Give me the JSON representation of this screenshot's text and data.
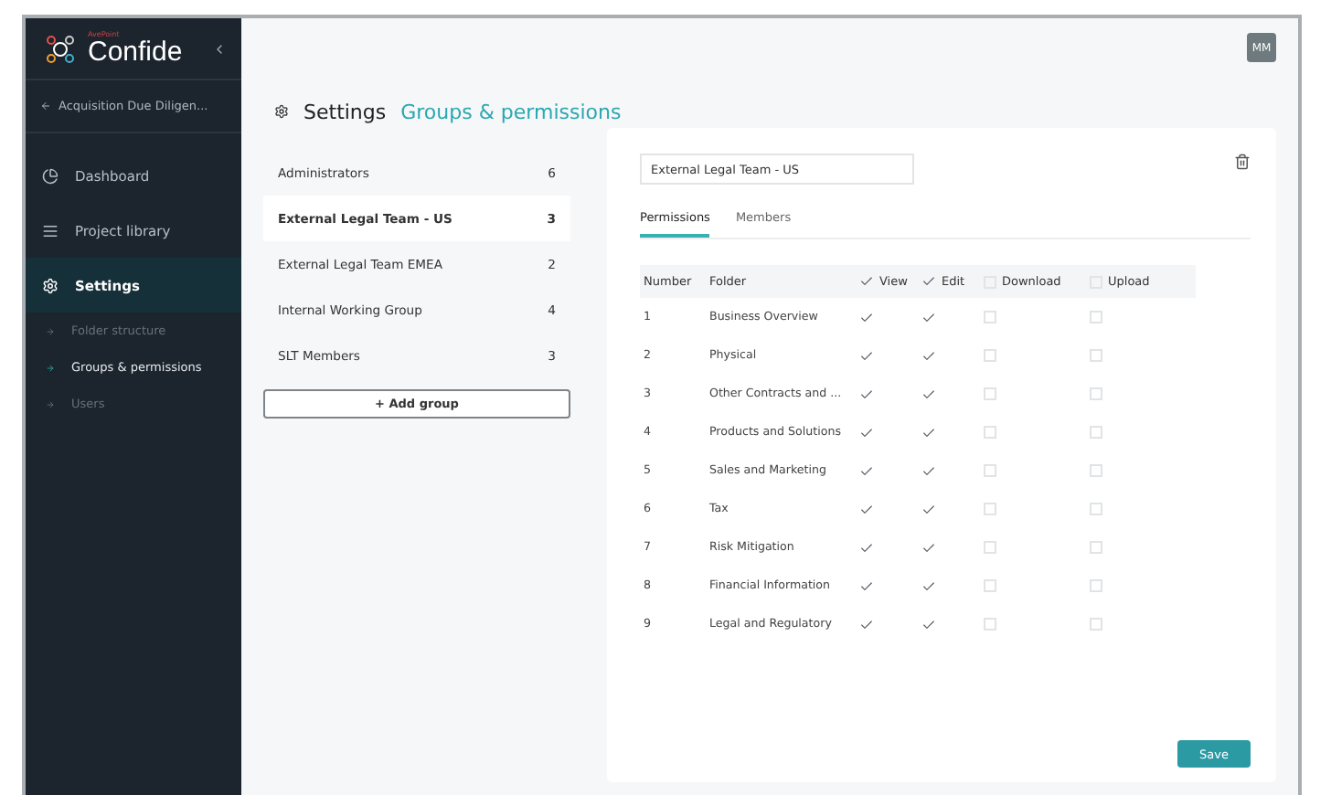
{
  "sidebar": {
    "brand_small": "AvePoint",
    "brand": "Confide",
    "back": "Acquisition Due Diligen...",
    "nav": [
      {
        "label": "Dashboard",
        "kind": "pie",
        "selected": false
      },
      {
        "label": "Project library",
        "kind": "list",
        "selected": false
      },
      {
        "label": "Settings",
        "kind": "gear",
        "selected": true
      }
    ],
    "sub": [
      {
        "label": "Folder structure",
        "selected": false
      },
      {
        "label": "Groups & permissions",
        "selected": true
      },
      {
        "label": "Users",
        "selected": false
      }
    ]
  },
  "header": {
    "avatar": "MM",
    "title": "Settings",
    "current": "Groups & permissions"
  },
  "groups": [
    {
      "name": "Administrators",
      "count": "6",
      "selected": false
    },
    {
      "name": "External Legal Team - US",
      "count": "3",
      "selected": true
    },
    {
      "name": "External Legal Team EMEA",
      "count": "2",
      "selected": false
    },
    {
      "name": "Internal Working Group",
      "count": "4",
      "selected": false
    },
    {
      "name": "SLT Members",
      "count": "3",
      "selected": false
    }
  ],
  "add_button": "+ Add group",
  "detail": {
    "name_value": "External Legal Team - US",
    "tabs": [
      {
        "label": "Permissions",
        "selected": true
      },
      {
        "label": "Members",
        "selected": false
      }
    ],
    "columns": [
      {
        "label": "Number",
        "kind": "text"
      },
      {
        "label": "Folder",
        "kind": "text"
      },
      {
        "label": "View",
        "kind": "check",
        "checked": true
      },
      {
        "label": "Edit",
        "kind": "check",
        "checked": true
      },
      {
        "label": "Download",
        "kind": "check",
        "checked": false
      },
      {
        "label": "Upload",
        "kind": "check",
        "checked": false
      }
    ],
    "rows": [
      {
        "number": "1",
        "folder": "Business Overview",
        "view": true,
        "edit": true,
        "download": false,
        "upload": false
      },
      {
        "number": "2",
        "folder": "Physical",
        "view": true,
        "edit": true,
        "download": false,
        "upload": false
      },
      {
        "number": "3",
        "folder": "Other Contracts and ...",
        "view": true,
        "edit": true,
        "download": false,
        "upload": false
      },
      {
        "number": "4",
        "folder": "Products and Solutions",
        "view": true,
        "edit": true,
        "download": false,
        "upload": false
      },
      {
        "number": "5",
        "folder": "Sales and Marketing",
        "view": true,
        "edit": true,
        "download": false,
        "upload": false
      },
      {
        "number": "6",
        "folder": "Tax",
        "view": true,
        "edit": true,
        "download": false,
        "upload": false
      },
      {
        "number": "7",
        "folder": "Risk Mitigation",
        "view": true,
        "edit": true,
        "download": false,
        "upload": false
      },
      {
        "number": "8",
        "folder": "Financial Information",
        "view": true,
        "edit": true,
        "download": false,
        "upload": false
      },
      {
        "number": "9",
        "folder": "Legal and Regulatory",
        "view": true,
        "edit": true,
        "download": false,
        "upload": false
      }
    ],
    "save": "Save"
  }
}
